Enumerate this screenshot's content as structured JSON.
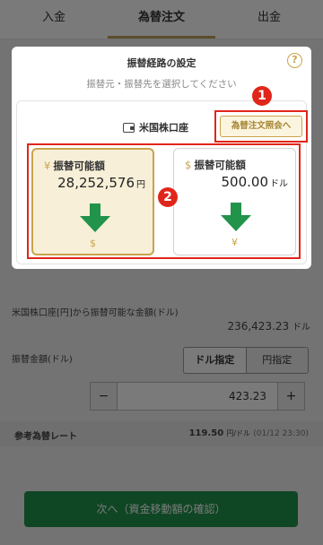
{
  "tabs": [
    {
      "label": "入金"
    },
    {
      "label": "為替注文"
    },
    {
      "label": "出金"
    }
  ],
  "dialog": {
    "title": "振替経路の設定",
    "help_icon": "?",
    "subtitle": "振替元・振替先を選択してください",
    "account": "米国株口座",
    "order_button": "為替注文照会へ",
    "cards": [
      {
        "currency_icon": "¥",
        "label": "振替可能額",
        "amount": "28,252,576",
        "unit": "円",
        "bottom_icon": "$"
      },
      {
        "currency_icon": "$",
        "label": "振替可能額",
        "amount": "500.00",
        "unit": "ドル",
        "bottom_icon": "¥"
      }
    ],
    "badges": [
      "1",
      "2"
    ]
  },
  "form": {
    "available_label": "米国株口座[円]から振替可能な金額(ドル)",
    "available_value": "236,423.23",
    "available_unit": "ドル",
    "amount_label": "振替金額(ドル)",
    "mode_options": [
      "ドル指定",
      "円指定"
    ],
    "minus": "−",
    "amount_value": "423.23",
    "plus": "+",
    "rate_label": "参考為替レート",
    "rate_value": "119.50",
    "rate_unit": "円/ドル",
    "rate_time": "(01/12 23:30)",
    "next_button": "次へ（資金移動額の確認）"
  },
  "colors": {
    "gold": "#c9a44b",
    "green": "#21934b",
    "red": "#e0261b"
  }
}
